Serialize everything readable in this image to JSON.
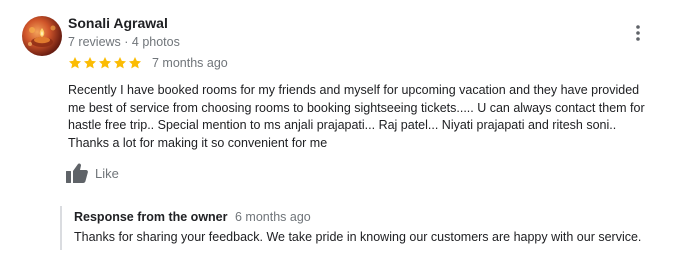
{
  "review": {
    "reviewer_name": "Sonali Agrawal",
    "reviewer_meta": "7 reviews · 4 photos",
    "rating": 5,
    "rating_max": 5,
    "date": "7 months ago",
    "text_lines": [
      "Recently I have booked rooms for my friends and myself for upcoming vacation and they have provided",
      "me best of service from choosing rooms to booking sightseeing tickets..... U can always contact them for",
      "hastle free trip.. Special mention to ms anjali prajapati... Raj patel... Niyati prajapati and ritesh soni..",
      "Thanks a lot for making it so convenient for me"
    ],
    "like_label": "Like",
    "more_icon": "vertical-dots-icon",
    "like_icon": "thumbs-up-icon",
    "star_icon": "star-icon"
  },
  "response": {
    "title": "Response from the owner",
    "date": "6 months ago",
    "text": "Thanks for sharing your feedback. We take pride in knowing our customers are happy with our service."
  },
  "colors": {
    "star": "#fbbc04",
    "primary_text": "#202124",
    "secondary_text": "#70757a",
    "divider": "#dadce0",
    "icon": "#5f6368"
  }
}
